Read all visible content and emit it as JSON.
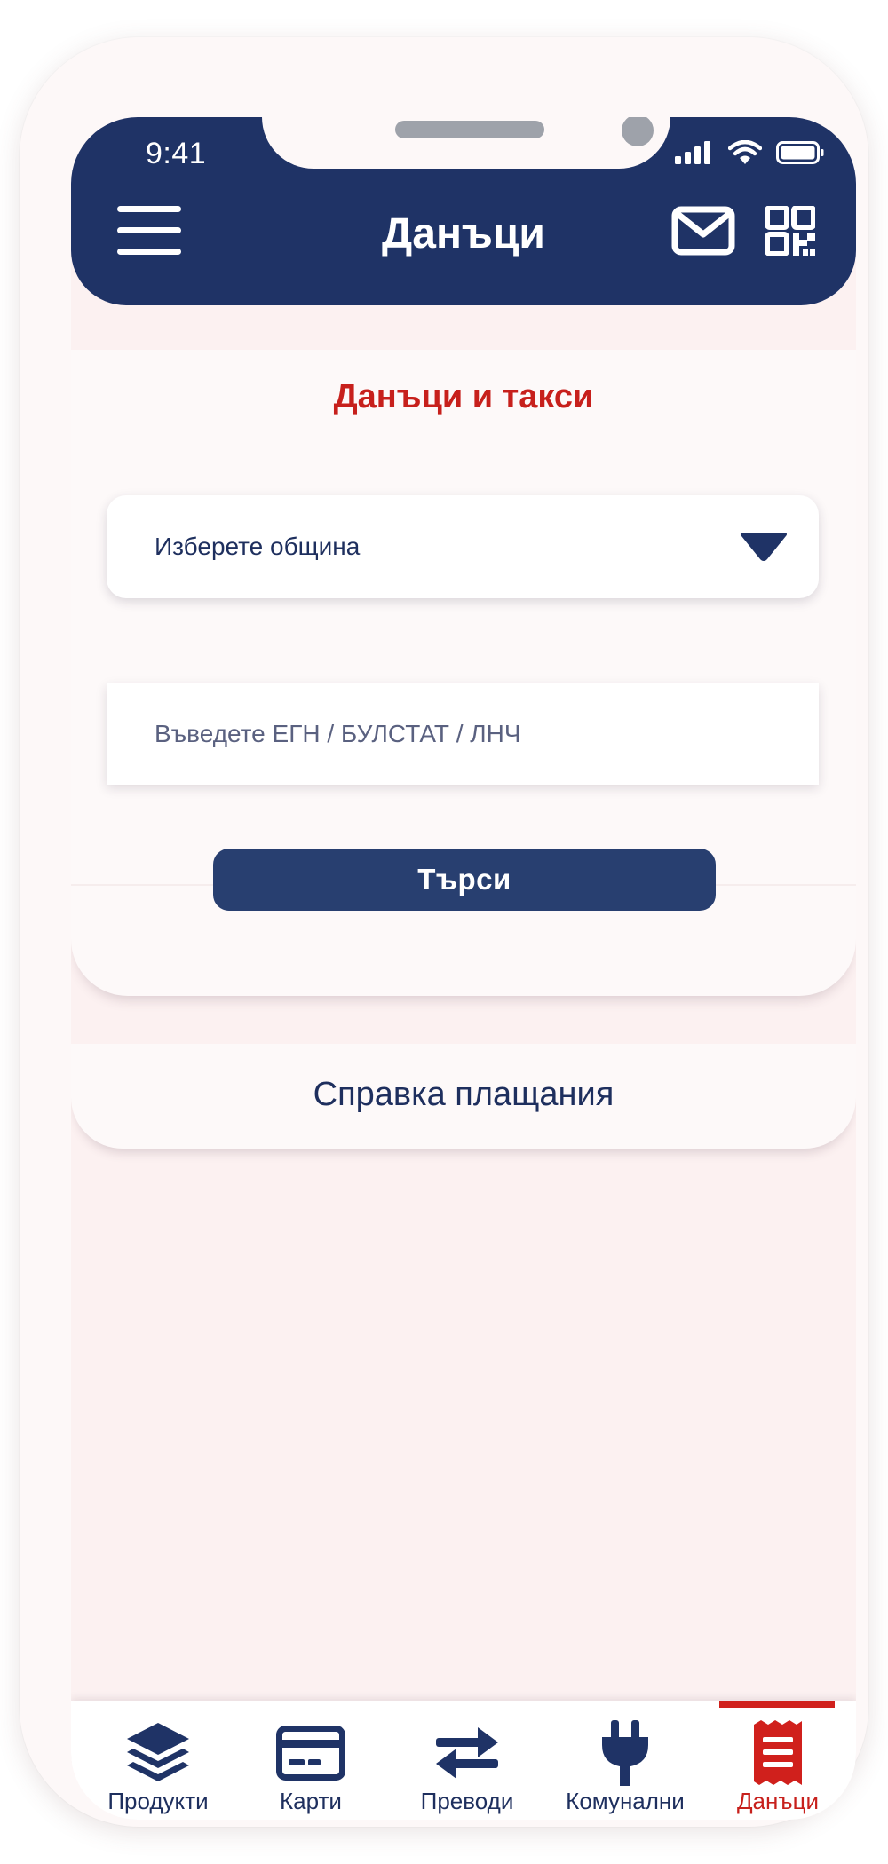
{
  "status_bar": {
    "time": "9:41"
  },
  "header": {
    "title": "Данъци"
  },
  "tax_card": {
    "title": "Данъци и такси",
    "municipality_select": {
      "value": "Изберете община"
    },
    "id_input": {
      "placeholder": "Въведете ЕГН / БУЛСТАТ / ЛНЧ",
      "value": ""
    },
    "search_button": "Търси"
  },
  "payments_card": {
    "title": "Справка плащания"
  },
  "tabs": [
    {
      "label": "Продукти",
      "icon": "layers-icon"
    },
    {
      "label": "Карти",
      "icon": "credit-card-icon"
    },
    {
      "label": "Преводи",
      "icon": "transfer-arrows-icon"
    },
    {
      "label": "Комунални",
      "icon": "plug-icon"
    },
    {
      "label": "Данъци",
      "icon": "receipt-icon",
      "active": true
    }
  ],
  "colors": {
    "primary": "#1f3366",
    "accent": "#c7201c",
    "screen_bg": "#fcf1f1"
  }
}
